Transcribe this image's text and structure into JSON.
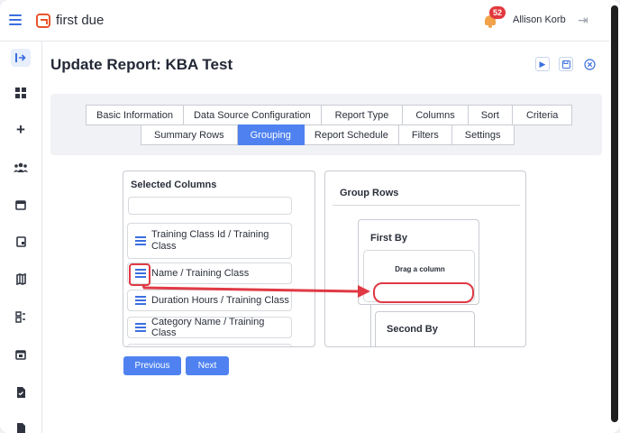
{
  "app": {
    "brand": "first due"
  },
  "header": {
    "notification_count": "52",
    "user_name": "Allison Korb"
  },
  "sidebar": {
    "icons": [
      "exit-to-sidebar-icon",
      "dashboard-icon",
      "plus-icon",
      "people-icon",
      "calendar-icon",
      "document-icon",
      "map-icon",
      "forms-icon",
      "calendar-check-icon",
      "file-check-icon",
      "file-icon"
    ]
  },
  "page": {
    "title": "Update Report: KBA Test"
  },
  "tabs_row1": [
    "Basic Information",
    "Data Source Configuration",
    "Report Type",
    "Columns",
    "Sort",
    "Criteria"
  ],
  "tabs_row2": [
    "Summary Rows",
    "Grouping",
    "Report Schedule",
    "Filters",
    "Settings"
  ],
  "active_tab": "Grouping",
  "selected_columns": {
    "title": "Selected Columns",
    "search_value": "",
    "items": [
      "Training Class Id / Training Class",
      "Name / Training Class",
      "Duration Hours / Training Class",
      "Category Name / Training Class"
    ]
  },
  "group_rows": {
    "title": "Group Rows",
    "first_by": "First By",
    "drag_hint": "Drag a column",
    "second_by": "Second By"
  },
  "buttons": {
    "previous": "Previous",
    "next": "Next"
  },
  "colors": {
    "accent": "#4f82f0",
    "annotation": "#e03a45",
    "brand": "#e8552c",
    "badge": "#e2373d"
  }
}
